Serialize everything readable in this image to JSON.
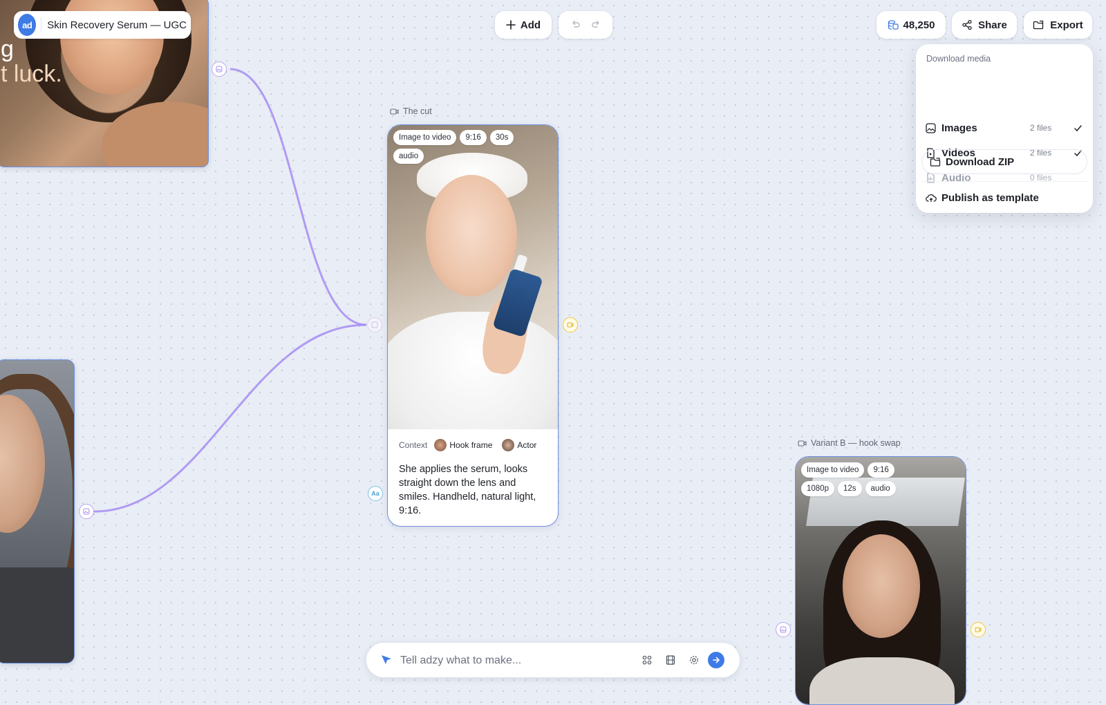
{
  "project": {
    "logo_text": "ad",
    "title": "Skin Recovery Serum — UGC"
  },
  "toolbar": {
    "add_label": "Add"
  },
  "header": {
    "credits": "48,250",
    "share_label": "Share",
    "export_label": "Export"
  },
  "export_menu": {
    "heading": "Download media",
    "items": [
      {
        "label": "Images",
        "count": "2 files",
        "checked": true
      },
      {
        "label": "Videos",
        "count": "2 files",
        "checked": true
      },
      {
        "label": "Audio",
        "count": "0 files",
        "checked": false
      }
    ],
    "download_zip": "Download ZIP",
    "publish": "Publish as template"
  },
  "image_node_1": {
    "overlay_line1": "g",
    "overlay_line2": "t luck."
  },
  "video_node_1": {
    "label": "The cut",
    "tags": [
      "Image to video",
      "9:16",
      "30s",
      "audio"
    ],
    "context_label": "Context",
    "context_chips": [
      "Hook frame",
      "Actor"
    ],
    "prompt": "She applies the serum, looks straight down the lens and smiles. Handheld, natural light, 9:16."
  },
  "video_node_2": {
    "label": "Variant B — hook swap",
    "tags": [
      "Image to video",
      "9:16",
      "1080p",
      "12s",
      "audio"
    ]
  },
  "text_handle_label": "Aa",
  "prompt_bar": {
    "placeholder": "Tell adzy what to make..."
  },
  "colors": {
    "accent": "#3f7be6",
    "edge": "#a48cf3",
    "output_handle": "#f0c840",
    "node_border": "#6c8fe0"
  }
}
